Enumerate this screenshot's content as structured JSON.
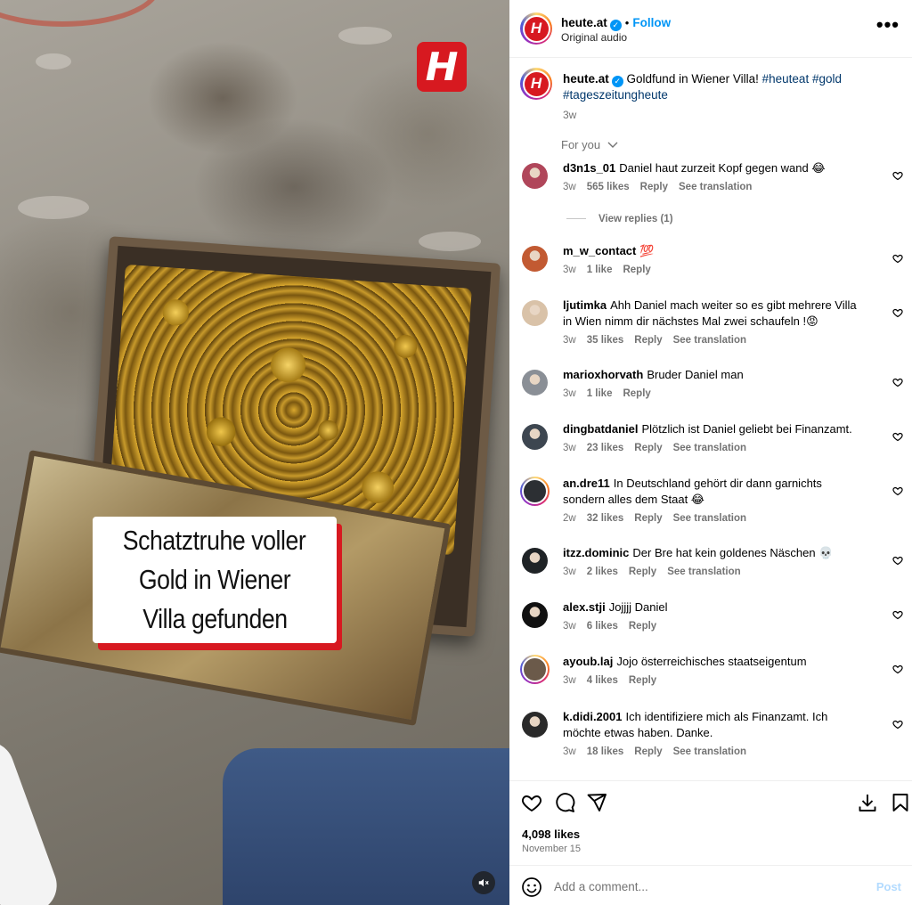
{
  "media": {
    "logo_letter": "H",
    "caption_lines": [
      "Schatztruhe voller",
      "Gold in Wiener",
      "Villa gefunden"
    ],
    "mute_icon": "speaker-muted-icon"
  },
  "header": {
    "username": "heute.at",
    "verified": true,
    "follow_label": "Follow",
    "audio_label": "Original audio",
    "more_label": "•••"
  },
  "caption": {
    "username": "heute.at",
    "text": "Goldfund in Wiener Villa!",
    "hashtags": [
      "#heuteat",
      "#gold",
      "#tageszeitungheute"
    ],
    "time": "3w"
  },
  "for_you_label": "For you",
  "comments": [
    {
      "user": "d3n1s_01",
      "text": "Daniel haut zurzeit Kopf gegen wand 😂",
      "time": "3w",
      "likes": "565 likes",
      "reply": "Reply",
      "translate": "See translation",
      "view_replies": "View replies (1)",
      "avatar_color": "#b0465a"
    },
    {
      "user": "m_w_contact",
      "text": "💯",
      "time": "3w",
      "likes": "1 like",
      "reply": "Reply",
      "translate": "",
      "avatar_color": "#c25a32"
    },
    {
      "user": "ljutimka",
      "text": "Ahh Daniel mach weiter so es gibt mehrere Villa in Wien nimm dir nächstes Mal zwei schaufeln !😡",
      "time": "3w",
      "likes": "35 likes",
      "reply": "Reply",
      "translate": "See translation",
      "avatar_color": "#d9c2a8"
    },
    {
      "user": "marioxhorvath",
      "text": "Bruder Daniel man",
      "time": "3w",
      "likes": "1 like",
      "reply": "Reply",
      "translate": "",
      "avatar_color": "#8a8f96"
    },
    {
      "user": "dingbatdaniel",
      "text": "Plötzlich ist Daniel geliebt bei Finanzamt.",
      "time": "3w",
      "likes": "23 likes",
      "reply": "Reply",
      "translate": "See translation",
      "avatar_color": "#3d4650"
    },
    {
      "user": "an.dre11",
      "text": "In Deutschland gehört dir dann garnichts sondern alles dem Staat 😂",
      "time": "2w",
      "likes": "32 likes",
      "reply": "Reply",
      "translate": "See translation",
      "avatar_color": "#2c2f33",
      "ring": true
    },
    {
      "user": "itzz.dominic",
      "text": "Der Bre hat kein goldenes Näschen 💀",
      "time": "3w",
      "likes": "2 likes",
      "reply": "Reply",
      "translate": "See translation",
      "avatar_color": "#1f2326"
    },
    {
      "user": "alex.stji",
      "text": "Jojjjj Daniel",
      "time": "3w",
      "likes": "6 likes",
      "reply": "Reply",
      "translate": "",
      "avatar_color": "#111111"
    },
    {
      "user": "ayoub.laj",
      "text": "Jojo österreichisches staatseigentum",
      "time": "3w",
      "likes": "4 likes",
      "reply": "Reply",
      "translate": "",
      "avatar_color": "#6b5a4a",
      "ring": true
    },
    {
      "user": "k.didi.2001",
      "text": "Ich identifiziere mich als Finanzamt. Ich möchte etwas haben. Danke.",
      "time": "3w",
      "likes": "18 likes",
      "reply": "Reply",
      "translate": "See translation",
      "avatar_color": "#2a2a2a"
    }
  ],
  "actions": {
    "likes": "4,098 likes",
    "date": "November 15"
  },
  "add_comment": {
    "placeholder": "Add a comment...",
    "post_label": "Post"
  },
  "colors": {
    "brand_red": "#d71920",
    "link_blue": "#0095f6",
    "hashtag": "#00376b",
    "muted": "#737373"
  }
}
